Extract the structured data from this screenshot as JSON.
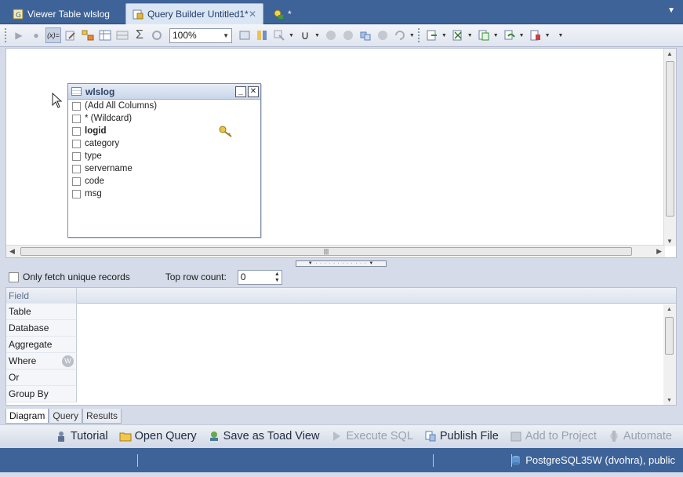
{
  "tabs": [
    {
      "label": "Viewer Table wlslog",
      "icon": "table-viewer-icon"
    },
    {
      "label": "Query Builder Untitled1*",
      "icon": "query-builder-icon",
      "close": "✕"
    },
    {
      "label": "*",
      "icon": "new-query-icon"
    }
  ],
  "toolbar": {
    "variable_label": "(x)=",
    "zoom_value": "100%"
  },
  "table_box": {
    "title": "wlslog",
    "minimize": "_",
    "close": "✕",
    "columns": [
      {
        "label": "(Add All Columns)",
        "bold": false
      },
      {
        "label": "* (Wildcard)",
        "bold": false
      },
      {
        "label": "logid",
        "bold": true
      },
      {
        "label": "category",
        "bold": false
      },
      {
        "label": "type",
        "bold": false
      },
      {
        "label": "servername",
        "bold": false
      },
      {
        "label": "code",
        "bold": false
      },
      {
        "label": "msg",
        "bold": false
      }
    ]
  },
  "options": {
    "unique_label": "Only fetch unique records",
    "top_row_label": "Top row count:",
    "top_row_value": "0"
  },
  "grid": {
    "rows": [
      "Field",
      "Table",
      "Database",
      "Aggregate",
      "Where",
      "Or",
      "Group By"
    ]
  },
  "bottom_tabs": [
    "Diagram",
    "Query",
    "Results"
  ],
  "actions": [
    {
      "label": "Tutorial",
      "enabled": true
    },
    {
      "label": "Open Query",
      "enabled": true
    },
    {
      "label": "Save as Toad View",
      "enabled": true
    },
    {
      "label": "Execute SQL",
      "enabled": false
    },
    {
      "label": "Publish File",
      "enabled": true
    },
    {
      "label": "Add to Project",
      "enabled": false
    },
    {
      "label": "Automate",
      "enabled": false
    }
  ],
  "status": {
    "connection": "PostgreSQL35W (dvohra), public"
  },
  "colors": {
    "titlebar": "#3e6398",
    "accent": "#c9d3e6"
  }
}
